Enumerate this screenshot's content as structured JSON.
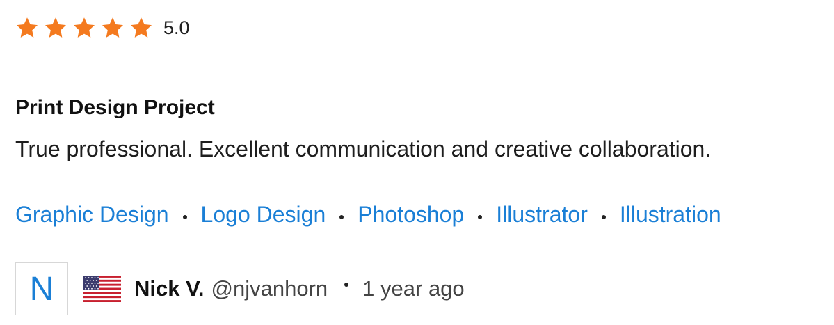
{
  "rating": {
    "stars": 5,
    "max": 5,
    "value_text": "5.0",
    "star_icon": "star-icon",
    "star_color": "#f47a1f"
  },
  "review": {
    "title": "Print Design Project",
    "body": "True professional. Excellent communication and creative collaboration."
  },
  "tags": [
    "Graphic Design",
    "Logo Design",
    "Photoshop",
    "Illustrator",
    "Illustration"
  ],
  "author": {
    "avatar_initial": "N",
    "flag_icon": "us-flag-icon",
    "name": "Nick V.",
    "handle": "@njvanhorn",
    "time_ago": "1 year ago"
  },
  "colors": {
    "link": "#1a7fd6",
    "star": "#f47a1f",
    "text": "#1c1c1c"
  }
}
